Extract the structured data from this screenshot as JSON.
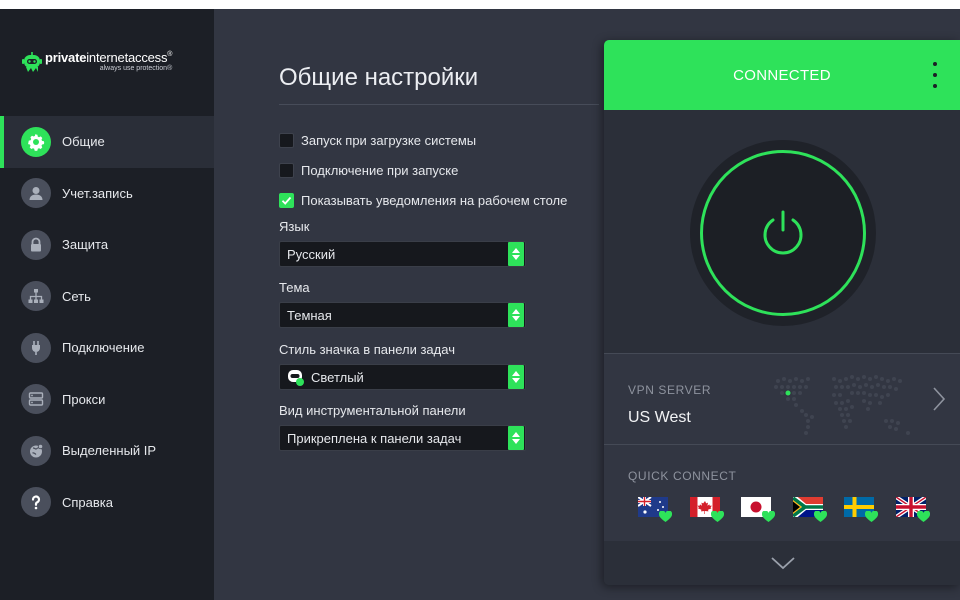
{
  "brand": {
    "name_bold": "private",
    "name_rest": "internetaccess",
    "reg": "®",
    "tagline": "always use protection",
    "tagline_reg": "®"
  },
  "sidebar": {
    "items": [
      {
        "label": "Общие",
        "icon": "gear-icon",
        "active": true
      },
      {
        "label": "Учет.запись",
        "icon": "user-icon",
        "active": false
      },
      {
        "label": "Защита",
        "icon": "lock-icon",
        "active": false
      },
      {
        "label": "Сеть",
        "icon": "network-icon",
        "active": false
      },
      {
        "label": "Подключение",
        "icon": "plug-icon",
        "active": false
      },
      {
        "label": "Прокси",
        "icon": "server-icon",
        "active": false
      },
      {
        "label": "Выделенный IP",
        "icon": "globe-icon",
        "active": false
      },
      {
        "label": "Справка",
        "icon": "question-icon",
        "active": false
      }
    ]
  },
  "settings": {
    "title": "Общие настройки",
    "checkboxes": [
      {
        "label": "Запуск при загрузке системы",
        "checked": false
      },
      {
        "label": "Подключение при запуске",
        "checked": false
      },
      {
        "label": "Показывать уведомления на рабочем столе",
        "checked": true
      }
    ],
    "language": {
      "label": "Язык",
      "value": "Русский"
    },
    "theme": {
      "label": "Тема",
      "value": "Темная"
    },
    "tray_icon": {
      "label": "Стиль значка в панели задач",
      "value": "Светлый"
    },
    "dashboard": {
      "label": "Вид инструментальной панели",
      "value": "Прикреплена к панели задач"
    }
  },
  "widget": {
    "status": "CONNECTED",
    "server_label": "VPN SERVER",
    "server_value": "US West",
    "quick_connect_label": "QUICK CONNECT",
    "flags": [
      "australia",
      "canada",
      "japan",
      "south-africa",
      "sweden",
      "united-kingdom"
    ]
  },
  "colors": {
    "accent": "#2ee25a",
    "sidebar_bg": "#1c1f26",
    "content_bg": "#323642"
  }
}
